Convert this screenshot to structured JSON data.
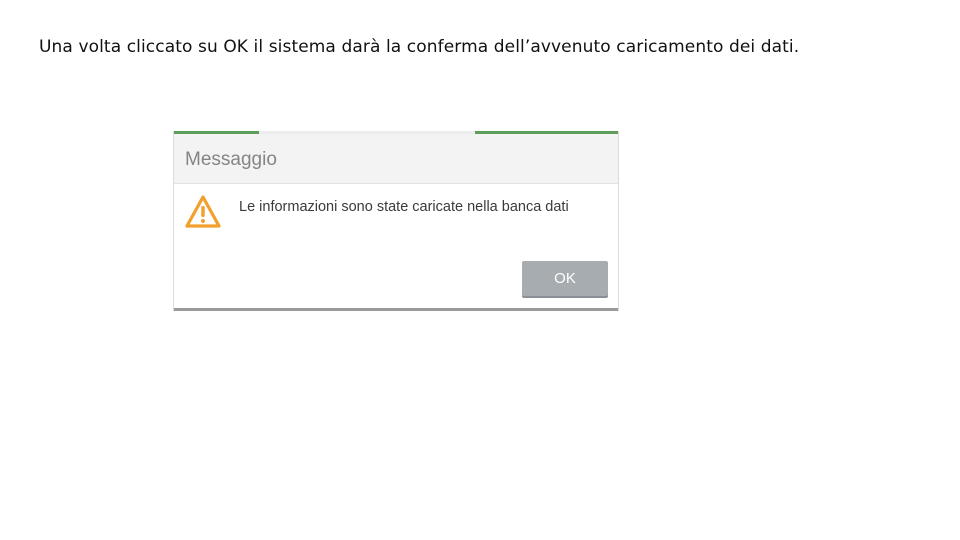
{
  "slide": {
    "caption": "Una volta cliccato su OK il sistema darà la conferma dell’avvenuto caricamento dei dati."
  },
  "dialog": {
    "title": "Messaggio",
    "icon": "warning-icon",
    "message": "Le informazioni sono state caricate nella banca dati",
    "ok_label": "OK"
  },
  "colors": {
    "accent_green": "#5e9e5a",
    "warning_orange": "#f2a02c",
    "button_gray": "#a7acb1",
    "header_gray": "#f3f3f3"
  }
}
